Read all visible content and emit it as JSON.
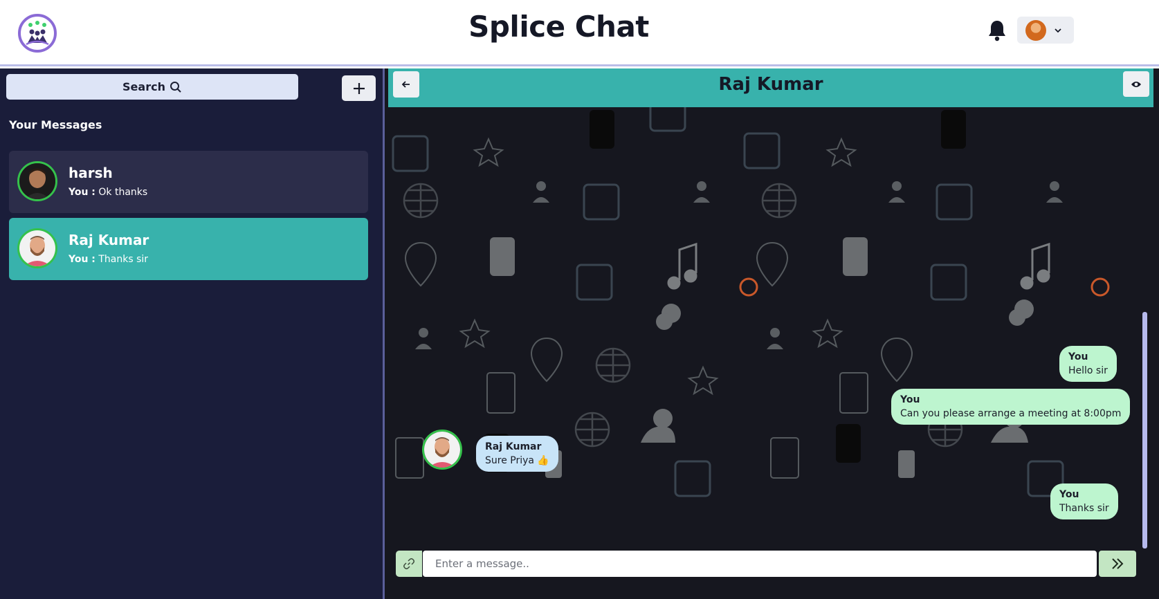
{
  "header": {
    "app_title": "Splice Chat",
    "logo_icon": "splice-community-logo",
    "notification_icon": "bell-icon",
    "profile_menu_icon": "chevron-down-icon"
  },
  "sidebar": {
    "search_label": "Search",
    "search_icon": "magnifier-icon",
    "add_icon": "plus-icon",
    "section_title": "Your Messages",
    "chats": [
      {
        "name": "harsh",
        "sender": "You :",
        "preview": "Ok thanks",
        "selected": false
      },
      {
        "name": "Raj Kumar",
        "sender": "You :",
        "preview": "Thanks sir",
        "selected": true
      }
    ]
  },
  "chat": {
    "title": "Raj Kumar",
    "back_icon": "arrow-left-icon",
    "view_icon": "eye-icon",
    "messages": [
      {
        "sender": "You",
        "text": "Hello sir",
        "mine": true
      },
      {
        "sender": "You",
        "text": "Can you please arrange a meeting at 8:00pm",
        "mine": true
      },
      {
        "sender": "Raj Kumar",
        "text": "Sure Priya 👍",
        "mine": false
      },
      {
        "sender": "You",
        "text": "Thanks sir",
        "mine": true
      }
    ],
    "composer": {
      "placeholder": "Enter a message..",
      "value": "",
      "attach_icon": "link-icon",
      "send_icon": "double-chevron-right-icon"
    }
  },
  "colors": {
    "sidebar_bg": "#1a1d3a",
    "accent_teal": "#38b2ac",
    "my_bubble": "#bdf5cf",
    "their_bubble": "#c8e4f8",
    "online_ring": "#35c24b"
  }
}
